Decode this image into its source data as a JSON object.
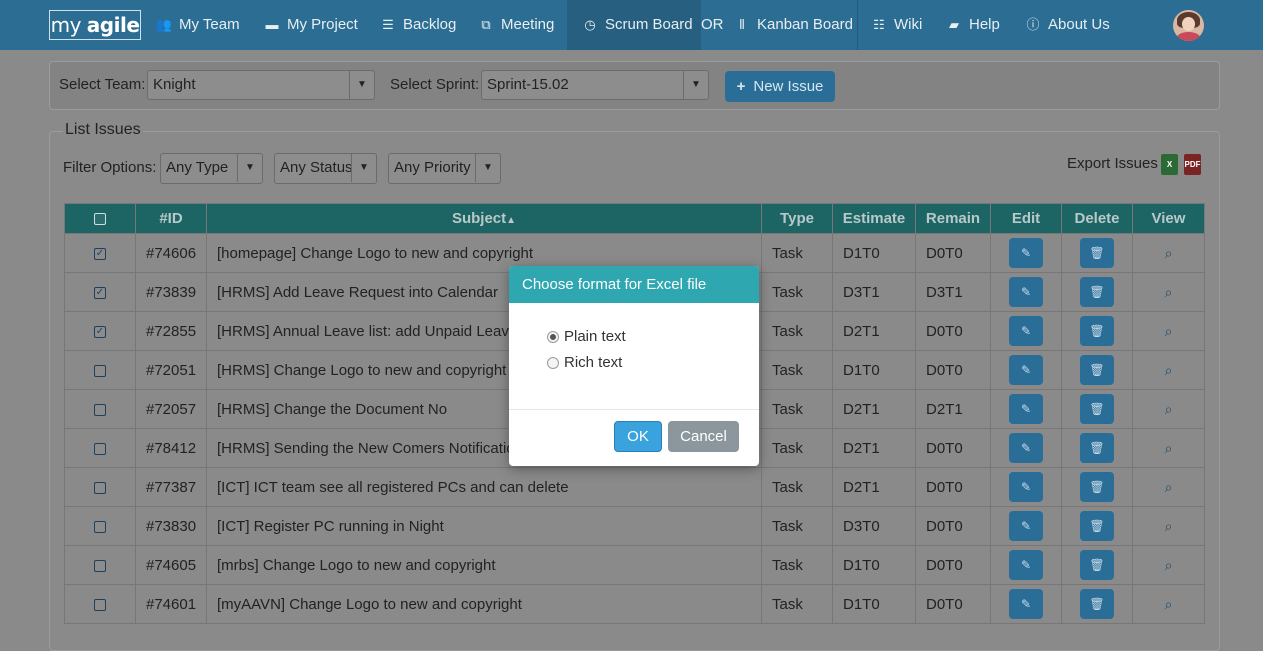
{
  "nav": {
    "logo_light": "my ",
    "logo_bold": "agile",
    "items": [
      {
        "label": "My Team",
        "icon": "users-icon"
      },
      {
        "label": "My Project",
        "icon": "folder-icon"
      },
      {
        "label": "Backlog",
        "icon": "list-icon"
      },
      {
        "label": "Meeting",
        "icon": "sitemap-icon"
      },
      {
        "label": "Scrum Board",
        "icon": "clock-icon"
      },
      {
        "label": "Kanban Board",
        "icon": "columns-icon"
      },
      {
        "label": "Wiki",
        "icon": "list-alt-icon"
      },
      {
        "label": "Help",
        "icon": "book-icon"
      },
      {
        "label": "About Us",
        "icon": "info-circle-icon"
      }
    ],
    "or_label": "OR"
  },
  "filters": {
    "team_label": "Select Team:",
    "team_value": "Knight",
    "sprint_label": "Select Sprint:",
    "sprint_value": "Sprint-15.02",
    "new_issue_label": "New Issue"
  },
  "list": {
    "legend": "List Issues",
    "filter_label": "Filter Options:",
    "type_value": "Any Type",
    "status_value": "Any Status",
    "priority_value": "Any Priority",
    "export_label": "Export Issues"
  },
  "table": {
    "headers": [
      "#ID",
      "Subject",
      "Type",
      "Estimate",
      "Remain",
      "Edit",
      "Delete",
      "View"
    ],
    "sort_arrow": "▲",
    "rows": [
      {
        "checked": true,
        "id": "#74606",
        "subject": "[homepage] Change Logo to new and copyright",
        "type": "Task",
        "estimate": "D1T0",
        "remain": "D0T0"
      },
      {
        "checked": true,
        "id": "#73839",
        "subject": "[HRMS] Add Leave Request into Calendar",
        "type": "Task",
        "estimate": "D3T1",
        "remain": "D3T1"
      },
      {
        "checked": true,
        "id": "#72855",
        "subject": "[HRMS] Annual Leave list: add Unpaid Leave c",
        "type": "Task",
        "estimate": "D2T1",
        "remain": "D0T0"
      },
      {
        "checked": false,
        "id": "#72051",
        "subject": "[HRMS] Change Logo to new and copyright 20",
        "type": "Task",
        "estimate": "D1T0",
        "remain": "D0T0"
      },
      {
        "checked": false,
        "id": "#72057",
        "subject": "[HRMS] Change the Document No",
        "type": "Task",
        "estimate": "D2T1",
        "remain": "D2T1"
      },
      {
        "checked": false,
        "id": "#78412",
        "subject": "[HRMS] Sending the New Comers Notification",
        "type": "Task",
        "estimate": "D2T1",
        "remain": "D0T0"
      },
      {
        "checked": false,
        "id": "#77387",
        "subject": "[ICT] ICT team see all registered PCs and can delete",
        "type": "Task",
        "estimate": "D2T1",
        "remain": "D0T0"
      },
      {
        "checked": false,
        "id": "#73830",
        "subject": "[ICT] Register PC running in Night",
        "type": "Task",
        "estimate": "D3T0",
        "remain": "D0T0"
      },
      {
        "checked": false,
        "id": "#74605",
        "subject": "[mrbs] Change Logo to new and copyright",
        "type": "Task",
        "estimate": "D1T0",
        "remain": "D0T0"
      },
      {
        "checked": false,
        "id": "#74601",
        "subject": "[myAAVN] Change Logo to new and copyright",
        "type": "Task",
        "estimate": "D1T0",
        "remain": "D0T0"
      }
    ]
  },
  "dialog": {
    "title": "Choose format for Excel file",
    "options": [
      {
        "label": "Plain text",
        "selected": true
      },
      {
        "label": "Rich text",
        "selected": false
      }
    ],
    "ok_label": "OK",
    "cancel_label": "Cancel"
  }
}
